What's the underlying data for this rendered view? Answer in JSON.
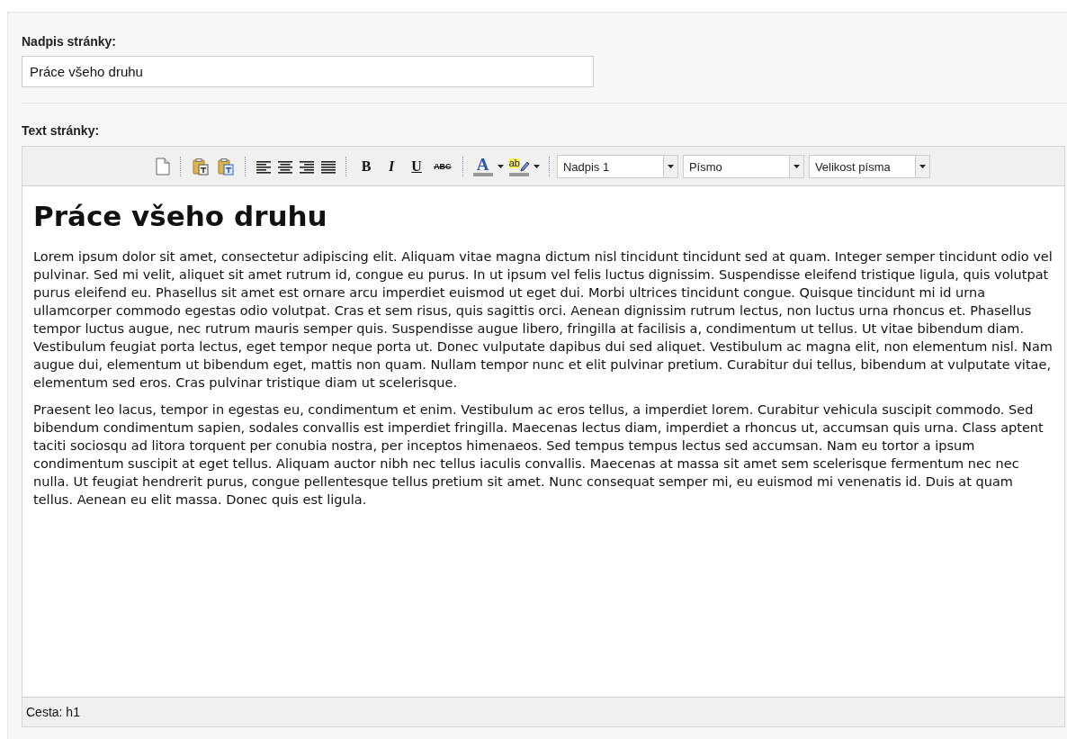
{
  "title_field": {
    "label": "Nadpis stránky:",
    "value": "Práce všeho druhu"
  },
  "editor": {
    "label": "Text stránky:",
    "toolbar": {
      "format_buttons": [
        "B",
        "I",
        "U",
        "ABC"
      ],
      "text_color_button": "A",
      "highlight_button": "ab",
      "dropdowns": [
        {
          "value": "Nadpis 1"
        },
        {
          "value": "Písmo"
        },
        {
          "value": "Velikost písma"
        }
      ]
    },
    "heading": "Práce všeho druhu",
    "paragraphs": [
      "Lorem ipsum dolor sit amet, consectetur adipiscing elit. Aliquam vitae magna dictum nisl tincidunt tincidunt sed at quam. Integer semper tincidunt odio vel pulvinar. Sed mi velit, aliquet sit amet rutrum id, congue eu purus. In ut ipsum vel felis luctus dignissim. Suspendisse eleifend tristique ligula, quis volutpat purus eleifend eu. Phasellus sit amet est ornare arcu imperdiet euismod ut eget dui. Morbi ultrices tincidunt congue. Quisque tincidunt mi id urna ullamcorper commodo egestas odio volutpat. Cras et sem risus, quis sagittis orci. Aenean dignissim rutrum lectus, non luctus urna rhoncus et. Phasellus tempor luctus augue, nec rutrum mauris semper quis. Suspendisse augue libero, fringilla at facilisis a, condimentum ut tellus. Ut vitae bibendum diam. Vestibulum feugiat porta lectus, eget tempor neque porta ut. Donec vulputate dapibus dui sed aliquet. Vestibulum ac magna elit, non elementum nisl. Nam augue dui, elementum ut bibendum eget, mattis non quam. Nullam tempor nunc et elit pulvinar pretium. Curabitur dui tellus, bibendum at vulputate vitae, elementum sed eros. Cras pulvinar tristique diam ut scelerisque.",
      "Praesent leo lacus, tempor in egestas eu, condimentum et enim. Vestibulum ac eros tellus, a imperdiet lorem. Curabitur vehicula suscipit commodo. Sed bibendum condimentum sapien, sodales convallis est imperdiet fringilla. Maecenas lectus diam, imperdiet a rhoncus ut, accumsan quis urna. Class aptent taciti sociosqu ad litora torquent per conubia nostra, per inceptos himenaeos. Sed tempus tempus lectus sed accumsan. Nam eu tortor a ipsum condimentum suscipit at eget tellus. Aliquam auctor nibh nec tellus iaculis convallis. Maecenas at massa sit amet sem scelerisque fermentum nec nec nulla. Ut feugiat hendrerit purus, congue pellentesque tellus pretium sit amet. Nunc consequat semper mi, eu euismod mi venenatis id. Duis at quam tellus. Aenean eu elit massa. Donec quis est ligula."
    ],
    "status_bar": "Cesta: h1"
  }
}
